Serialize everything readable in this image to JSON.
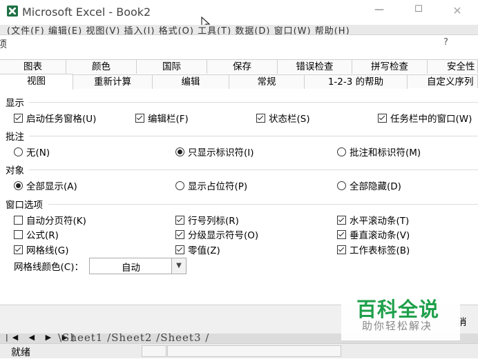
{
  "window": {
    "title": "Microsoft Excel - Book2",
    "minimize": "—",
    "maximize": "☐",
    "close": "✕",
    "menubar_fragment": "(文件(F)  编辑(E)  视图(V)  插入(I)  格式(O)  工具(T)  数据(D)  窗口(W)  帮助(H)"
  },
  "dialog": {
    "title": "项",
    "help": "?",
    "tabs_row1": [
      "图表",
      "颜色",
      "国际",
      "保存",
      "错误检查",
      "拼写检查",
      "安全性"
    ],
    "tabs_row2": [
      "视图",
      "重新计算",
      "编辑",
      "常规",
      "1-2-3 的帮助",
      "自定义序列"
    ],
    "active_tab": "视图",
    "sections": {
      "show": {
        "title": "显示",
        "options": [
          {
            "label": "启动任务窗格(U)",
            "checked": true
          },
          {
            "label": "编辑栏(F)",
            "checked": true
          },
          {
            "label": "状态栏(S)",
            "checked": true
          },
          {
            "label": "任务栏中的窗口(W)",
            "checked": true
          }
        ]
      },
      "comments": {
        "title": "批注",
        "options": [
          {
            "label": "无(N)",
            "selected": false
          },
          {
            "label": "只显示标识符(I)",
            "selected": true
          },
          {
            "label": "批注和标识符(M)",
            "selected": false
          }
        ]
      },
      "objects": {
        "title": "对象",
        "options": [
          {
            "label": "全部显示(A)",
            "selected": true
          },
          {
            "label": "显示占位符(P)",
            "selected": false
          },
          {
            "label": "全部隐藏(D)",
            "selected": false
          }
        ]
      },
      "window_options": {
        "title": "窗口选项",
        "options": [
          {
            "label": "自动分页符(K)",
            "checked": false
          },
          {
            "label": "行号列标(R)",
            "checked": true
          },
          {
            "label": "水平滚动条(T)",
            "checked": true
          },
          {
            "label": "公式(R)",
            "checked": false
          },
          {
            "label": "分级显示符号(O)",
            "checked": true
          },
          {
            "label": "垂直滚动条(V)",
            "checked": true
          },
          {
            "label": "网格线(G)",
            "checked": true
          },
          {
            "label": "零值(Z)",
            "checked": true
          },
          {
            "label": "工作表标签(B)",
            "checked": true
          }
        ],
        "gridline_color_label": "网格线颜色(C)：",
        "gridline_color_value": "自动"
      }
    },
    "cancel_fragment": "消"
  },
  "sheetbar": {
    "nav": "|◀ ◀ ▶ ▶|",
    "tabs_text": "\\Sheet1 /Sheet2 /Sheet3 /"
  },
  "status": {
    "text": "就绪"
  },
  "watermark": {
    "main": "百科全说",
    "sub": "助你轻松解决"
  },
  "colors": {
    "accent_green": "#1ea04a",
    "excel_green": "#1e7145"
  }
}
